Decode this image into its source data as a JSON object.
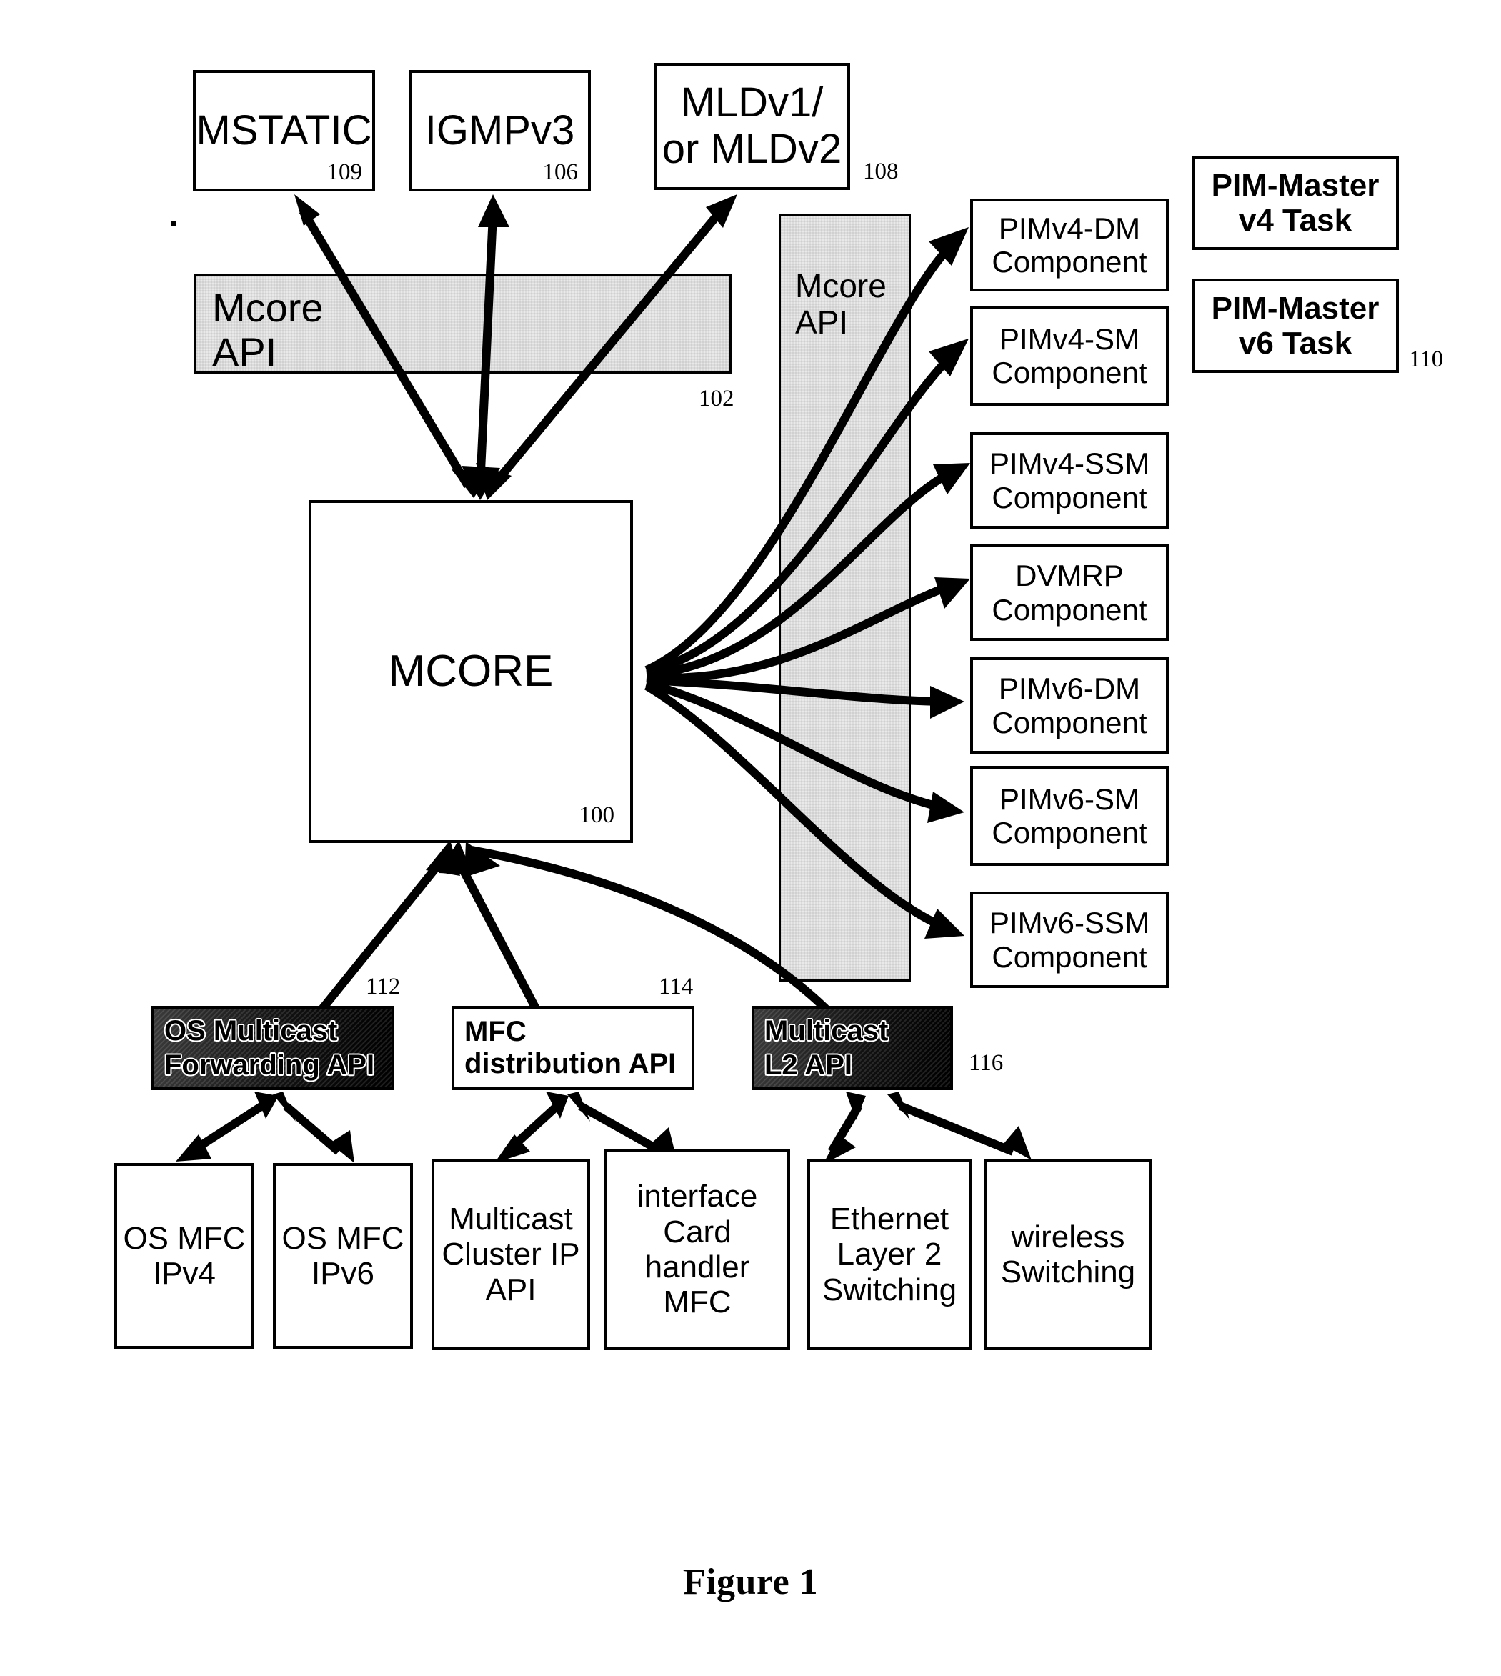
{
  "figure": {
    "caption": "Figure 1"
  },
  "top_protocol_boxes": [
    {
      "id": "mstatic",
      "label": "MSTATIC",
      "ref": "109"
    },
    {
      "id": "igmpv3",
      "label": "IGMPv3",
      "ref": "106"
    },
    {
      "id": "mld",
      "label": "MLDv1/\nor MLDv2",
      "ref": "108"
    }
  ],
  "api_bands": [
    {
      "id": "mcore-api-horizontal",
      "label": "Mcore\nAPI",
      "ref": "102"
    },
    {
      "id": "mcore-api-vertical",
      "label": "Mcore\nAPI",
      "ref": ""
    }
  ],
  "core": {
    "label": "MCORE",
    "ref": "100"
  },
  "component_boxes": [
    {
      "id": "pimv4-dm",
      "label": "PIMv4-DM\nComponent"
    },
    {
      "id": "pimv4-sm",
      "label": "PIMv4-SM\nComponent"
    },
    {
      "id": "pimv4-ssm",
      "label": "PIMv4-SSM\nComponent"
    },
    {
      "id": "dvmrp",
      "label": "DVMRP\nComponent"
    },
    {
      "id": "pimv6-dm",
      "label": "PIMv6-DM\nComponent"
    },
    {
      "id": "pimv6-sm",
      "label": "PIMv6-SM\nComponent"
    },
    {
      "id": "pimv6-ssm",
      "label": "PIMv6-SSM\nComponent"
    }
  ],
  "task_boxes": {
    "ref": "110",
    "items": [
      {
        "id": "pim-master-v4",
        "label": "PIM-Master\nv4 Task"
      },
      {
        "id": "pim-master-v6",
        "label": "PIM-Master\nv6 Task"
      }
    ]
  },
  "mid_api_boxes": [
    {
      "id": "os-multicast-forwarding-api",
      "label": "OS Multicast\nForwarding API",
      "ref": "112",
      "style": "dark"
    },
    {
      "id": "mfc-distribution-api",
      "label": "MFC\ndistribution API",
      "ref": "114",
      "style": "light"
    },
    {
      "id": "multicast-l2-api",
      "label": "Multicast\nL2 API",
      "ref": "116",
      "style": "dark"
    }
  ],
  "bottom_boxes": [
    {
      "id": "os-mfc-ipv4",
      "label": "OS MFC\nIPv4"
    },
    {
      "id": "os-mfc-ipv6",
      "label": "OS MFC\nIPv6"
    },
    {
      "id": "multicast-cluster-ip-api",
      "label": "Multicast\nCluster IP\nAPI"
    },
    {
      "id": "interface-card-handler",
      "label": "interface\nCard\nhandler\nMFC"
    },
    {
      "id": "ethernet-layer2",
      "label": "Ethernet\nLayer 2\nSwitching"
    },
    {
      "id": "wireless-switching",
      "label": "wireless\nSwitching"
    }
  ],
  "colors": {
    "stroke": "#000000",
    "paper": "#ffffff",
    "band_fill": "#e9e9e9",
    "dark_fill": "#111111"
  }
}
